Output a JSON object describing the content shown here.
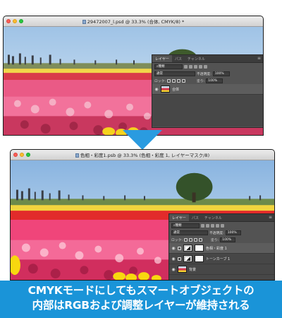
{
  "top_window": {
    "title": "29472007_l.psd @ 33.3% (合体, CMYK/8) *",
    "panel": {
      "tabs": [
        "レイヤー",
        "パス",
        "チャンネル"
      ],
      "filter_label": "種類",
      "blend_mode": "通常",
      "opacity_label": "不透明度:",
      "opacity_value": "100%",
      "lock_label": "ロック:",
      "fill_label": "塗り:",
      "fill_value": "100%",
      "layers": [
        {
          "name": "合体",
          "thumb": "image",
          "selected": true
        }
      ]
    }
  },
  "bottom_window": {
    "title": "色相・彩度1.psb @ 33.3% (色相・彩度 1, レイヤーマスク/8)",
    "panel": {
      "tabs": [
        "レイヤー",
        "パス",
        "チャンネル"
      ],
      "filter_label": "種類",
      "blend_mode": "通常",
      "opacity_label": "不透明度:",
      "opacity_value": "100%",
      "lock_label": "ロック:",
      "fill_label": "塗り:",
      "fill_value": "100%",
      "layers": [
        {
          "name": "色相・彩度 1",
          "thumb": "adjustment",
          "selected": true
        },
        {
          "name": "トーンカーブ 1",
          "thumb": "adjustment",
          "selected": false
        },
        {
          "name": "背景",
          "thumb": "image",
          "selected": false
        }
      ]
    }
  },
  "caption": {
    "line1": "CMYKモードにしてもスマートオブジェクトの",
    "line2": "内部はRGBおよび調整レイヤーが維持される"
  },
  "colors": {
    "caption_bg": "#1a94d8",
    "arrow": "#2a9be0",
    "panel_bg": "#535353"
  }
}
